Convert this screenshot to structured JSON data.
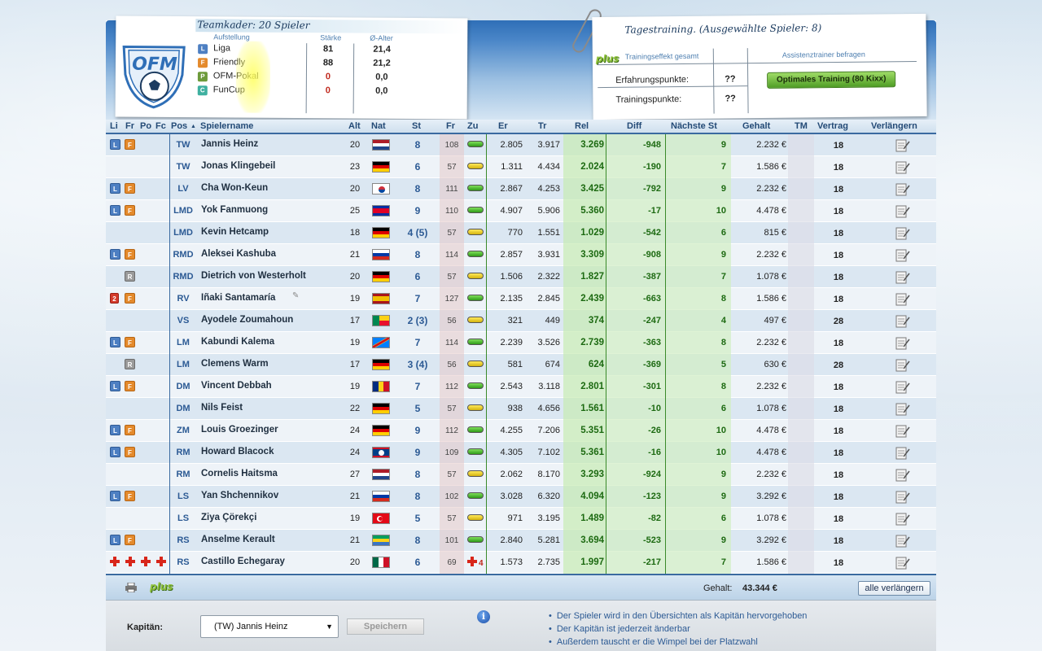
{
  "team": {
    "title": "Teamkader: 20 Spieler",
    "col_lineup": "Aufstellung",
    "col_strength": "Stärke",
    "col_age": "Ø-Alter",
    "competitions": [
      {
        "badge": "L",
        "name": "Liga",
        "strength": "81",
        "age": "21,4",
        "color": "#4d7fc2"
      },
      {
        "badge": "F",
        "name": "Friendly",
        "strength": "88",
        "age": "21,2",
        "color": "#e48a2c"
      },
      {
        "badge": "P",
        "name": "OFM-Pokal",
        "strength": "0",
        "age": "0,0",
        "color": "#6d9a3a"
      },
      {
        "badge": "C",
        "name": "FunCup",
        "strength": "0",
        "age": "0,0",
        "color": "#3fb0a0"
      }
    ]
  },
  "training": {
    "title": "Tagestraining.  (Ausgewählte Spieler: 8)",
    "plus": "plus",
    "col1": "Trainingseffekt gesamt",
    "col2": "Assistenztrainer befragen",
    "xp_label": "Erfahrungspunkte:",
    "xp_value": "??",
    "tp_label": "Trainingspunkte:",
    "tp_value": "??",
    "optimal_button": "Optimales Training (80 Kixx)"
  },
  "columns": {
    "li": "Li",
    "fr": "Fr",
    "po": "Po",
    "fc": "Fc",
    "pos": "Pos",
    "name": "Spielername",
    "alt": "Alt",
    "nat": "Nat",
    "st": "St",
    "fr2": "Fr",
    "zu": "Zu",
    "er": "Er",
    "tr": "Tr",
    "rel": "Rel",
    "diff": "Diff",
    "next": "Nächste St",
    "gehalt": "Gehalt",
    "tm": "TM",
    "vertrag": "Vertrag",
    "verlaengern": "Verlängern"
  },
  "players": [
    {
      "badges": [
        "L",
        "F"
      ],
      "pos": "TW",
      "name": "Jannis Heinz",
      "age": "20",
      "flag": "nl",
      "st": "8",
      "fr": "108",
      "zu": "green",
      "er": "2.805",
      "tr": "3.917",
      "rel": "3.269",
      "diff": "-948",
      "next": "9",
      "gehalt": "2.232 €",
      "vertrag": "18"
    },
    {
      "badges": [],
      "pos": "TW",
      "name": "Jonas Klingebeil",
      "age": "23",
      "flag": "de",
      "st": "6",
      "fr": "57",
      "zu": "yellow",
      "er": "1.311",
      "tr": "4.434",
      "rel": "2.024",
      "diff": "-190",
      "next": "7",
      "gehalt": "1.586 €",
      "vertrag": "18"
    },
    {
      "badges": [
        "L",
        "F"
      ],
      "pos": "LV",
      "name": "Cha Won-Keun",
      "age": "20",
      "flag": "kr",
      "st": "8",
      "fr": "111",
      "zu": "green",
      "er": "2.867",
      "tr": "4.253",
      "rel": "3.425",
      "diff": "-792",
      "next": "9",
      "gehalt": "2.232 €",
      "vertrag": "18"
    },
    {
      "badges": [
        "L",
        "F"
      ],
      "pos": "LMD",
      "name": "Yok Fanmuong",
      "age": "25",
      "flag": "kh",
      "st": "9",
      "fr": "110",
      "zu": "green",
      "er": "4.907",
      "tr": "5.906",
      "rel": "5.360",
      "diff": "-17",
      "next": "10",
      "gehalt": "4.478 €",
      "vertrag": "18"
    },
    {
      "badges": [],
      "pos": "LMD",
      "name": "Kevin Hetcamp",
      "age": "18",
      "flag": "de",
      "st": "4 (5)",
      "fr": "57",
      "zu": "yellow",
      "er": "770",
      "tr": "1.551",
      "rel": "1.029",
      "diff": "-542",
      "next": "6",
      "gehalt": "815 €",
      "vertrag": "18"
    },
    {
      "badges": [
        "L",
        "F"
      ],
      "pos": "RMD",
      "name": "Aleksei Kashuba",
      "age": "21",
      "flag": "ru",
      "st": "8",
      "fr": "114",
      "zu": "green",
      "er": "2.857",
      "tr": "3.931",
      "rel": "3.309",
      "diff": "-908",
      "next": "9",
      "gehalt": "2.232 €",
      "vertrag": "18"
    },
    {
      "badges": [
        "R"
      ],
      "pos": "RMD",
      "name": "Dietrich von Westerholt",
      "age": "20",
      "flag": "de",
      "st": "6",
      "fr": "57",
      "zu": "yellow",
      "er": "1.506",
      "tr": "2.322",
      "rel": "1.827",
      "diff": "-387",
      "next": "7",
      "gehalt": "1.078 €",
      "vertrag": "18"
    },
    {
      "badges": [
        "2",
        "F"
      ],
      "pos": "RV",
      "name": "Iñaki Santamaría",
      "age": "19",
      "flag": "es",
      "st": "7",
      "fr": "127",
      "zu": "green",
      "er": "2.135",
      "tr": "2.845",
      "rel": "2.439",
      "diff": "-663",
      "next": "8",
      "gehalt": "1.586 €",
      "vertrag": "18"
    },
    {
      "badges": [],
      "pos": "VS",
      "name": "Ayodele Zoumahoun",
      "age": "17",
      "flag": "bj",
      "st": "2 (3)",
      "fr": "56",
      "zu": "yellow",
      "er": "321",
      "tr": "449",
      "rel": "374",
      "diff": "-247",
      "next": "4",
      "gehalt": "497 €",
      "vertrag": "28"
    },
    {
      "badges": [
        "L",
        "F"
      ],
      "pos": "LM",
      "name": "Kabundi Kalema",
      "age": "19",
      "flag": "cd",
      "st": "7",
      "fr": "114",
      "zu": "green",
      "er": "2.239",
      "tr": "3.526",
      "rel": "2.739",
      "diff": "-363",
      "next": "8",
      "gehalt": "2.232 €",
      "vertrag": "18"
    },
    {
      "badges": [
        "R"
      ],
      "pos": "LM",
      "name": "Clemens Warm",
      "age": "17",
      "flag": "de",
      "st": "3 (4)",
      "fr": "56",
      "zu": "yellow",
      "er": "581",
      "tr": "674",
      "rel": "624",
      "diff": "-369",
      "next": "5",
      "gehalt": "630 €",
      "vertrag": "28"
    },
    {
      "badges": [
        "L",
        "F"
      ],
      "pos": "DM",
      "name": "Vincent Debbah",
      "age": "19",
      "flag": "ro",
      "st": "7",
      "fr": "112",
      "zu": "green",
      "er": "2.543",
      "tr": "3.118",
      "rel": "2.801",
      "diff": "-301",
      "next": "8",
      "gehalt": "2.232 €",
      "vertrag": "18"
    },
    {
      "badges": [],
      "pos": "DM",
      "name": "Nils Feist",
      "age": "22",
      "flag": "de",
      "st": "5",
      "fr": "57",
      "zu": "yellow",
      "er": "938",
      "tr": "4.656",
      "rel": "1.561",
      "diff": "-10",
      "next": "6",
      "gehalt": "1.078 €",
      "vertrag": "18"
    },
    {
      "badges": [
        "L",
        "F"
      ],
      "pos": "ZM",
      "name": "Louis Groezinger",
      "age": "24",
      "flag": "de",
      "st": "9",
      "fr": "112",
      "zu": "green",
      "er": "4.255",
      "tr": "7.206",
      "rel": "5.351",
      "diff": "-26",
      "next": "10",
      "gehalt": "4.478 €",
      "vertrag": "18"
    },
    {
      "badges": [
        "L",
        "F"
      ],
      "pos": "RM",
      "name": "Howard Blacock",
      "age": "24",
      "flag": "bz",
      "st": "9",
      "fr": "109",
      "zu": "green",
      "er": "4.305",
      "tr": "7.102",
      "rel": "5.361",
      "diff": "-16",
      "next": "10",
      "gehalt": "4.478 €",
      "vertrag": "18"
    },
    {
      "badges": [],
      "pos": "RM",
      "name": "Cornelis Haitsma",
      "age": "27",
      "flag": "nl",
      "st": "8",
      "fr": "57",
      "zu": "yellow",
      "er": "2.062",
      "tr": "8.170",
      "rel": "3.293",
      "diff": "-924",
      "next": "9",
      "gehalt": "2.232 €",
      "vertrag": "18"
    },
    {
      "badges": [
        "L",
        "F"
      ],
      "pos": "LS",
      "name": "Yan Shchennikov",
      "age": "21",
      "flag": "ru",
      "st": "8",
      "fr": "102",
      "zu": "green",
      "er": "3.028",
      "tr": "6.320",
      "rel": "4.094",
      "diff": "-123",
      "next": "9",
      "gehalt": "3.292 €",
      "vertrag": "18"
    },
    {
      "badges": [],
      "pos": "LS",
      "name": "Ziya Çörekçi",
      "age": "19",
      "flag": "tr",
      "st": "5",
      "fr": "57",
      "zu": "yellow",
      "er": "971",
      "tr": "3.195",
      "rel": "1.489",
      "diff": "-82",
      "next": "6",
      "gehalt": "1.078 €",
      "vertrag": "18"
    },
    {
      "badges": [
        "L",
        "F"
      ],
      "pos": "RS",
      "name": "Anselme Kerault",
      "age": "21",
      "flag": "ga",
      "st": "8",
      "fr": "101",
      "zu": "green",
      "er": "2.840",
      "tr": "5.281",
      "rel": "3.694",
      "diff": "-523",
      "next": "9",
      "gehalt": "3.292 €",
      "vertrag": "18"
    },
    {
      "badges": [
        "+",
        "+",
        "+",
        "+"
      ],
      "pos": "RS",
      "name": "Castillo Echegaray",
      "age": "20",
      "flag": "mx",
      "st": "6",
      "fr": "69",
      "zu": "injury",
      "injury_days": "4",
      "er": "1.573",
      "tr": "2.735",
      "rel": "1.997",
      "diff": "-217",
      "next": "7",
      "gehalt": "1.586 €",
      "vertrag": "18"
    }
  ],
  "footer": {
    "plus": "plus",
    "gehalt_label": "Gehalt:",
    "gehalt_value": "43.344 €",
    "renew_all": "alle verlängern"
  },
  "captain": {
    "label": "Kapitän:",
    "selected": "(TW) Jannis Heinz",
    "save": "Speichern",
    "notes": [
      "Der Spieler wird in den Übersichten als Kapitän hervorgehoben",
      "Der Kapitän ist jederzeit änderbar",
      "Außerdem tauscht er die Wimpel bei der Platzwahl"
    ]
  }
}
